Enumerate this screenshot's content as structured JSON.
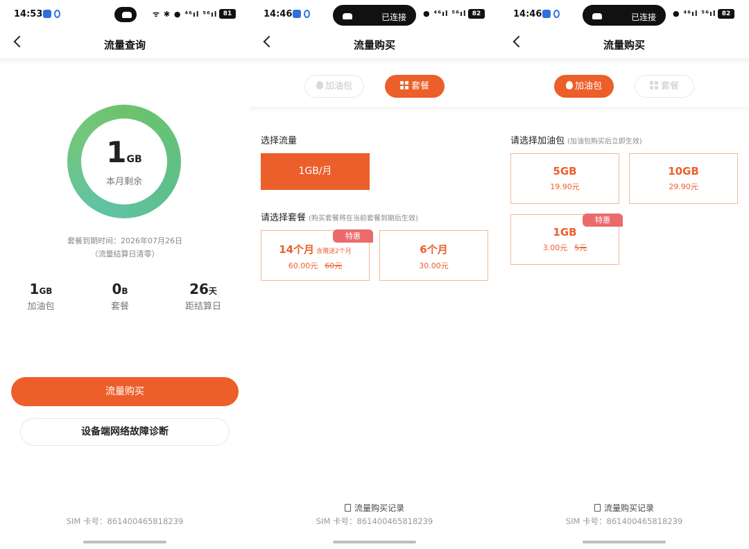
{
  "screen1": {
    "status": {
      "time": "14:53",
      "right": "ᯤ ✱ ● ⁴⁶ıl ⁵⁶ıl",
      "battery": "81"
    },
    "nav": {
      "title": "流量查询"
    },
    "ring": {
      "value": "1",
      "unit": "GB",
      "label": "本月剩余"
    },
    "expiry": {
      "line1": "套餐到期时间：2026年07月26日",
      "line2": "（流量结算日清零）"
    },
    "stats": [
      {
        "value": "1",
        "unit": "GB",
        "label": "加油包"
      },
      {
        "value": "0",
        "unit": "B",
        "label": "套餐"
      },
      {
        "value": "26",
        "unit": "天",
        "label": "距结算日"
      }
    ],
    "buy_button": "流量购买",
    "diag_button": "设备端网络故障诊断",
    "sim": "SIM 卡号：861400465818239"
  },
  "screen2": {
    "status": {
      "time": "14:46",
      "car_text": "已连接",
      "right": "● ⁴⁶ıl ⁵⁶ıl",
      "battery": "82"
    },
    "nav": {
      "title": "流量购买"
    },
    "tabs": [
      {
        "label": "加油包",
        "active": false
      },
      {
        "label": "套餐",
        "active": true
      }
    ],
    "select_title": "选择流量",
    "flow_option": "1GB/月",
    "plan_title": "请选择套餐",
    "plan_hint": "(购买套餐将在当前套餐到期后生效)",
    "plans": [
      {
        "name": "14个月",
        "gift": "含赠送2个月",
        "price": "60.00元",
        "original": "60元",
        "badge": "特惠"
      },
      {
        "name": "6个月",
        "price": "30.00元"
      }
    ],
    "records": "流量购买记录",
    "sim": "SIM 卡号：861400465818239"
  },
  "screen3": {
    "status": {
      "time": "14:46",
      "car_text": "已连接",
      "right": "● ⁴⁶ıl ⁵⁶ıl",
      "battery": "82"
    },
    "nav": {
      "title": "流量购买"
    },
    "tabs": [
      {
        "label": "加油包",
        "active": true
      },
      {
        "label": "套餐",
        "active": false
      }
    ],
    "pack_title": "请选择加油包",
    "pack_hint": "(加油包购买后立即生效)",
    "packs": [
      {
        "name": "5GB",
        "price": "19.90元"
      },
      {
        "name": "10GB",
        "price": "29.90元"
      },
      {
        "name": "1GB",
        "price": "3.00元",
        "original": "5元",
        "badge": "特惠"
      }
    ],
    "records": "流量购买记录",
    "sim": "SIM 卡号：861400465818239"
  },
  "colors": {
    "accent": "#ec5f2a",
    "badge": "#eb6b6b",
    "ring": "#6cc36c"
  }
}
